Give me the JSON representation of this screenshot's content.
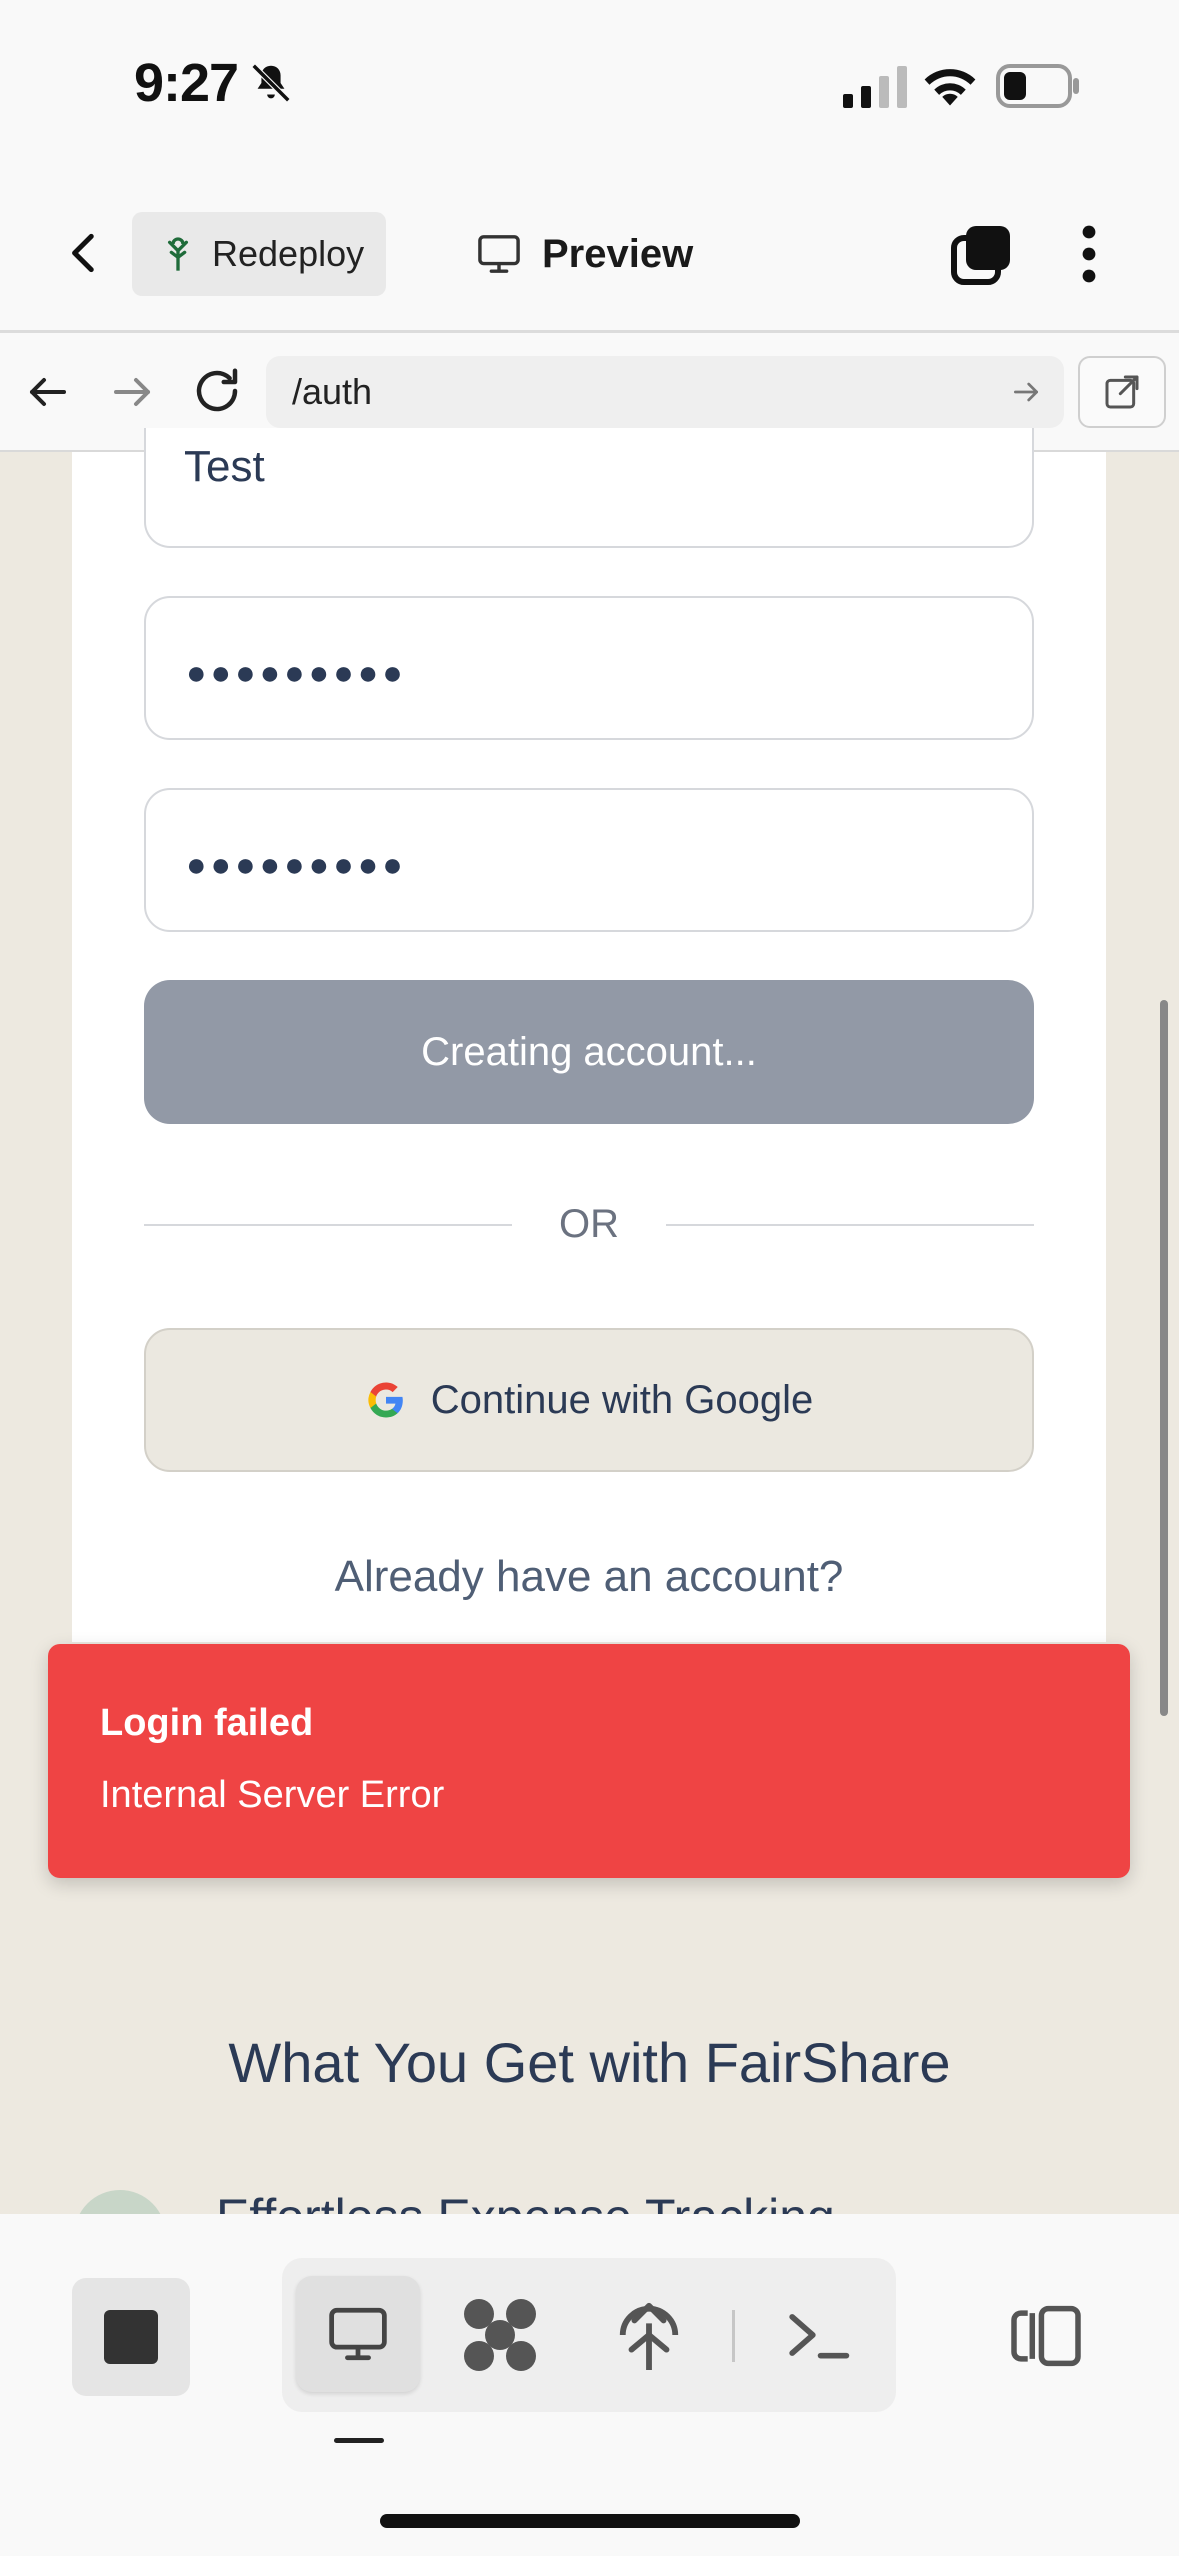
{
  "status_bar": {
    "time": "9:27"
  },
  "header": {
    "redeploy_label": "Redeploy",
    "preview_label": "Preview"
  },
  "browser": {
    "url": "/auth"
  },
  "form": {
    "name_value": "Test",
    "password_mask": "●●●●●●●●●",
    "confirm_mask": "●●●●●●●●●",
    "submit_label": "Creating account...",
    "or_label": "OR",
    "google_label": "Continue with Google",
    "have_account_link": "Already have an account?"
  },
  "toast": {
    "title": "Login failed",
    "message": "Internal Server Error",
    "color": "#ef4444"
  },
  "features": {
    "heading": "What You Get with FairShare",
    "first_item": "Effortless Expense Tracking"
  },
  "icons": [
    "bell-slash-icon",
    "signal-icon",
    "wifi-icon",
    "battery-icon",
    "back-icon",
    "seedling-icon",
    "monitor-icon",
    "layers-icon",
    "more-vertical-icon",
    "arrow-left-icon",
    "arrow-right-icon",
    "reload-icon",
    "external-link-icon",
    "google-icon",
    "stop-icon",
    "nodes-icon",
    "deploy-icon",
    "terminal-icon",
    "split-view-icon"
  ],
  "colors": {
    "accent_button_disabled": "#9299a6",
    "page_bg": "#ede9e0",
    "text_primary": "#2b3a55"
  }
}
